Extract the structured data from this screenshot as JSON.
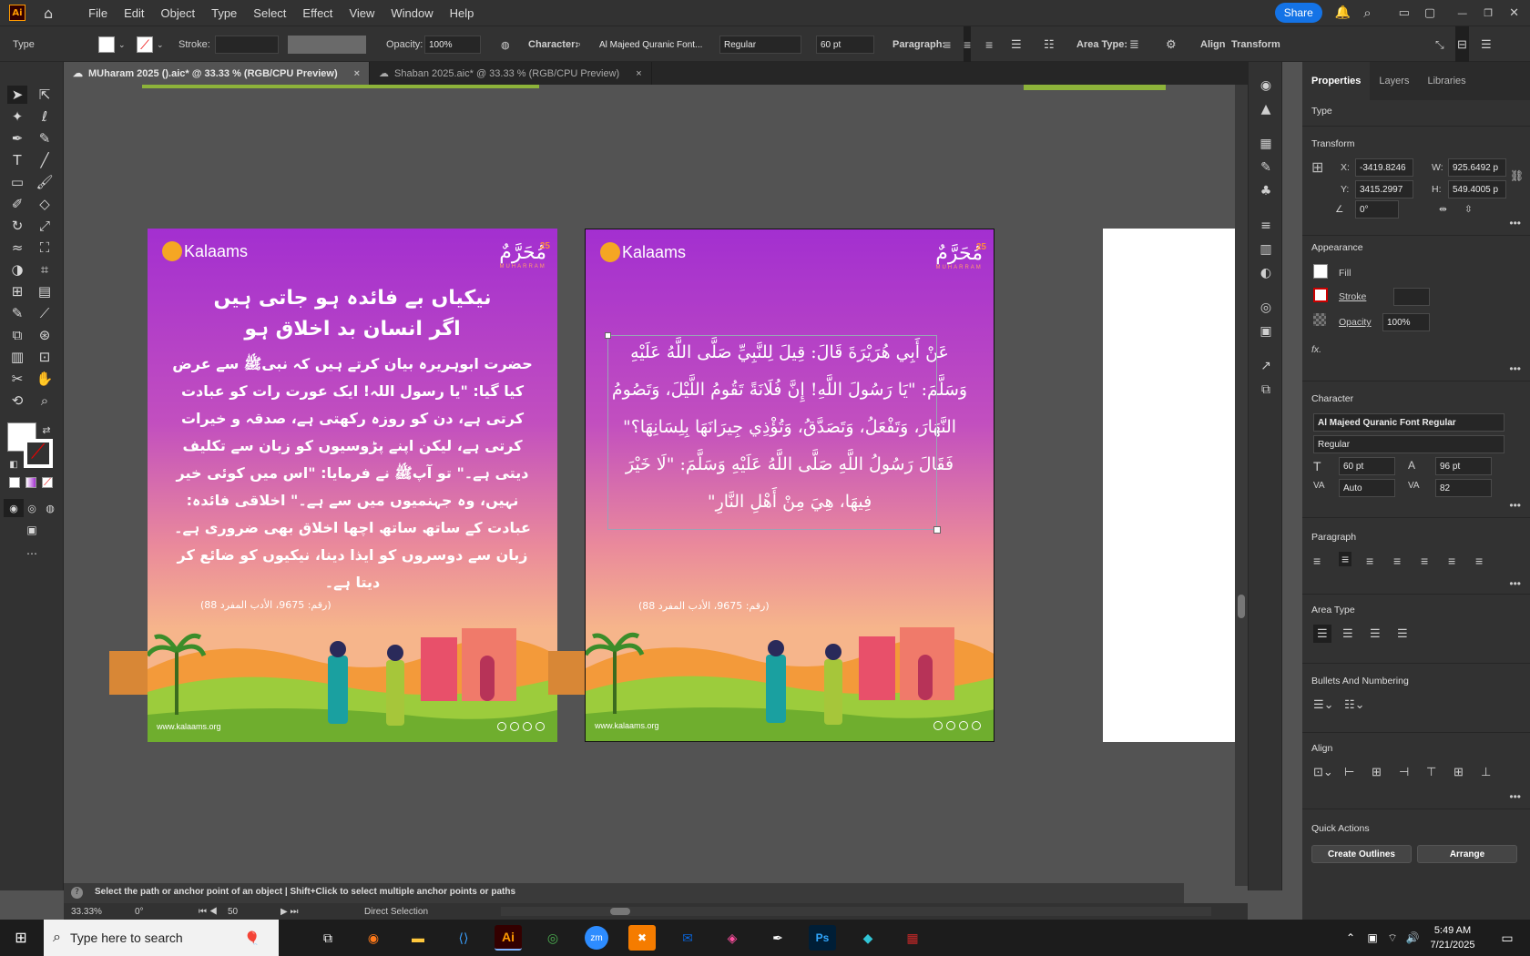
{
  "app": {
    "logo": "Ai",
    "menu": [
      "File",
      "Edit",
      "Object",
      "Type",
      "Select",
      "Effect",
      "View",
      "Window",
      "Help"
    ],
    "share_label": "Share"
  },
  "control_bar": {
    "selection_type": "Type",
    "stroke_label": "Stroke:",
    "opacity_label": "Opacity:",
    "opacity_value": "100%",
    "character_label": "Character:",
    "font_family": "Al Majeed Quranic Font...",
    "font_style": "Regular",
    "font_size": "60 pt",
    "paragraph_label": "Paragraph:",
    "area_type_label": "Area Type:",
    "align_label": "Align",
    "transform_label": "Transform"
  },
  "tabs": [
    {
      "label": "MUharam 2025 ().aic* @ 33.33 % (RGB/CPU Preview)",
      "close": "×"
    },
    {
      "label": "Shaban 2025.aic* @ 33.33 % (RGB/CPU Preview)",
      "close": "×"
    }
  ],
  "artboard1": {
    "brand": "Kalaams",
    "muharram": "مُحَرَّمٌ",
    "muharram_num": "25",
    "muharram_sub": "MUHARRAM",
    "title_line1": "نیکیاں بے فائدہ ہو جاتی ہیں",
    "title_line2": "اگر انسان بد اخلاق ہو",
    "body": "حضرت ابوہریرہ بیان کرتے ہیں کہ نبیﷺ سے عرض کیا گیا: \"یا رسول اللہ! ایک عورت رات کو عبادت کرتی ہے، دن کو روزہ رکھتی ہے، صدقہ و خیرات کرتی ہے، لیکن اپنے پڑوسیوں کو زبان سے تکلیف دیتی ہے۔\" تو آپﷺ نے فرمایا: \"اس میں کوئی خیر نہیں، وہ جہنمیوں میں سے ہے۔\" اخلاقی فائدہ: عبادت کے ساتھ ساتھ اچھا اخلاق بھی ضروری ہے۔ زبان سے دوسروں کو ایذا دینا، نیکیوں کو ضائع کر دیتا ہے۔",
    "reference": "(رقم: 9675، الأدب المفرد 88)",
    "website": "www.kalaams.org"
  },
  "artboard2": {
    "brand": "Kalaams",
    "muharram": "مُحَرَّمٌ",
    "muharram_num": "25",
    "muharram_sub": "MUHARRAM",
    "arabic": "عَنْ أَبِي هُرَيْرَةَ قَالَ: قِيلَ لِلنَّبِيِّ صَلَّى اللَّهُ عَلَيْهِ وَسَلَّمَ: \"يَا رَسُولَ اللَّهِ! إِنَّ فُلَانَةً تَقُومُ اللَّيْلَ، وَتَصُومُ النَّهَارَ، وَتَفْعَلُ، وَتَصَدَّقُ، وَتُؤْذِي جِيرَانَهَا بِلِسَانِهَا؟\" فَقَالَ رَسُولُ اللَّهِ صَلَّى اللَّهُ عَلَيْهِ وَسَلَّمَ: \"لَا خَيْرَ فِيهَا، هِيَ مِنْ أَهْلِ النَّارِ\"",
    "reference": "(رقم: 9675، الأدب المفرد 88)",
    "website": "www.kalaams.org"
  },
  "properties": {
    "tabs": [
      "Properties",
      "Layers",
      "Libraries"
    ],
    "type_heading": "Type",
    "transform_heading": "Transform",
    "x_label": "X:",
    "x_value": "-3419.8246",
    "y_label": "Y:",
    "y_value": "3415.2997",
    "w_label": "W:",
    "w_value": "925.6492 p",
    "h_label": "H:",
    "h_value": "549.4005 p",
    "angle_value": "0°",
    "appearance_heading": "Appearance",
    "fill_label": "Fill",
    "stroke_label": "Stroke",
    "opacity_label": "Opacity",
    "opacity_value": "100%",
    "fx_label": "fx.",
    "character_heading": "Character",
    "font_family": "Al Majeed Quranic Font Regular",
    "font_style": "Regular",
    "font_size": "60 pt",
    "leading": "96 pt",
    "kerning": "Auto",
    "tracking": "82",
    "paragraph_heading": "Paragraph",
    "area_type_heading": "Area Type",
    "bullets_heading": "Bullets And Numbering",
    "align_heading": "Align",
    "quick_actions_heading": "Quick Actions",
    "create_outlines_label": "Create Outlines",
    "arrange_label": "Arrange"
  },
  "status": {
    "hint": "Select the path or anchor point of an object  |  Shift+Click to select multiple anchor points or paths",
    "zoom": "33.33%",
    "rotation": "0°",
    "artboard_num": "50",
    "tool_name": "Direct Selection"
  },
  "taskbar": {
    "search_placeholder": "Type here to search",
    "time": "5:49 AM",
    "date": "7/21/2025"
  },
  "colors": {
    "accent": "#1473e6",
    "artboard_purple": "#a32fd0",
    "sunset": "#f6b58b",
    "green_strip": "#8db33a"
  }
}
